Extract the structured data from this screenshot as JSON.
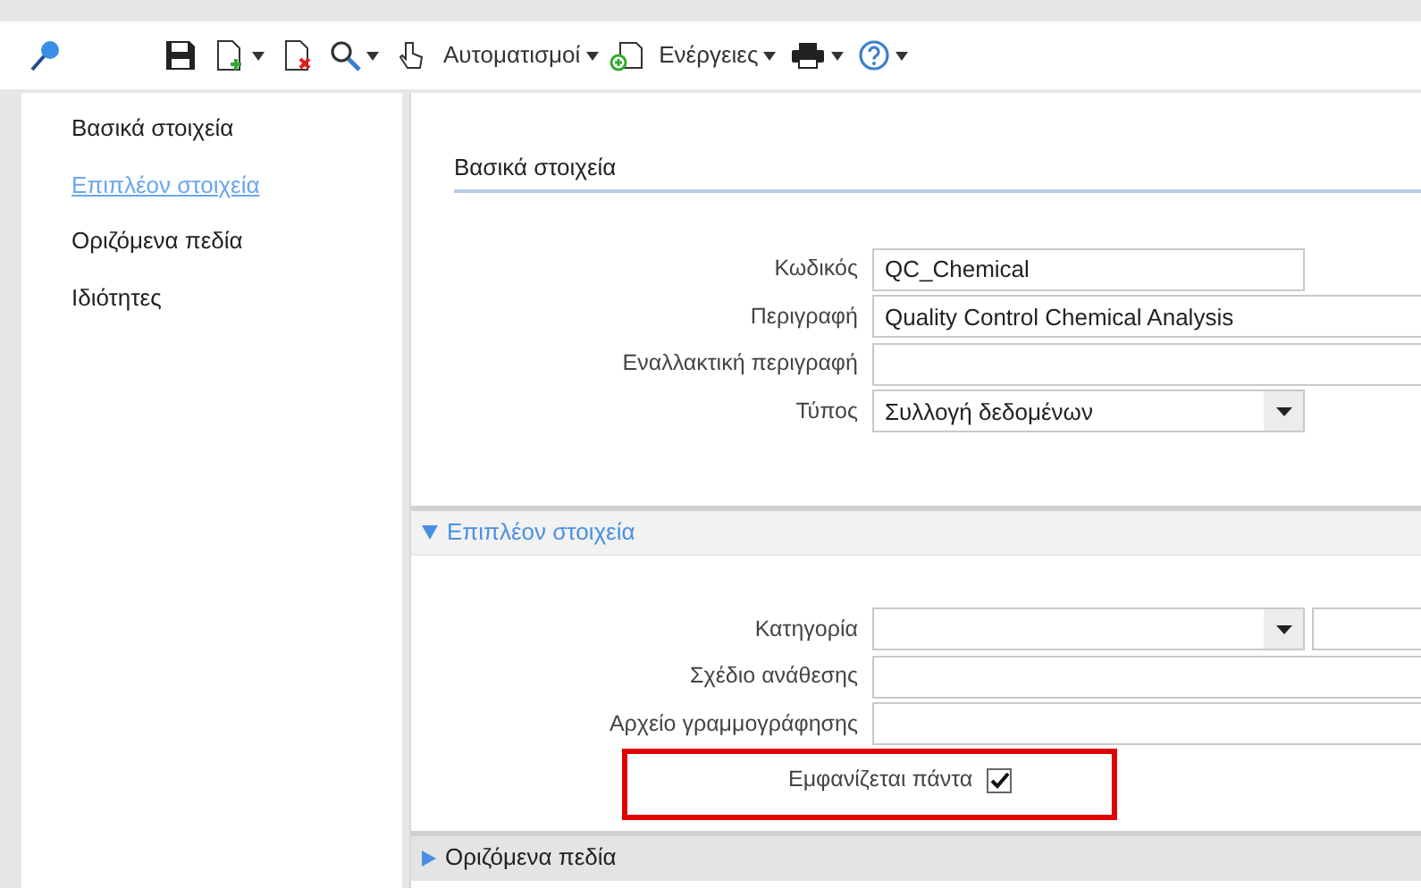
{
  "toolbar": {
    "menus": [
      {
        "label": "Αυτοματισμοί"
      },
      {
        "label": "Ενέργειες"
      }
    ]
  },
  "sidebar": {
    "items": [
      {
        "label": "Βασικά στοιχεία",
        "selected": false
      },
      {
        "label": "Επιπλέον στοιχεία",
        "selected": true
      },
      {
        "label": "Οριζόμενα πεδία",
        "selected": false
      },
      {
        "label": "Ιδιότητες",
        "selected": false
      }
    ]
  },
  "sections": [
    {
      "title": "Βασικά στοιχεία",
      "kind": "plain",
      "fields": [
        {
          "label": "Κωδικός",
          "kind": "short_text",
          "value": "QC_Chemical"
        },
        {
          "label": "Περιγραφή",
          "kind": "text",
          "value": "Quality Control Chemical Analysis"
        },
        {
          "label": "Εναλλακτική περιγραφή",
          "kind": "text"
        },
        {
          "label": "Τύπος",
          "kind": "select",
          "value": "Συλλογή δεδομένων"
        }
      ]
    },
    {
      "title": "Επιπλέον στοιχεία",
      "kind": "collapsible",
      "expanded": true,
      "fields": [
        {
          "label": "Κατηγορία",
          "kind": "select_pair"
        },
        {
          "label": "Σχέδιο ανάθεσης",
          "kind": "text"
        },
        {
          "label": "Αρχείο γραμμογράφησης",
          "kind": "text"
        },
        {
          "label": "Εμφανίζεται πάντα",
          "kind": "checkbox",
          "checked": true,
          "highlighted": true
        }
      ]
    },
    {
      "title": "Οριζόμενα πεδία",
      "kind": "collapsible",
      "expanded": false
    }
  ]
}
